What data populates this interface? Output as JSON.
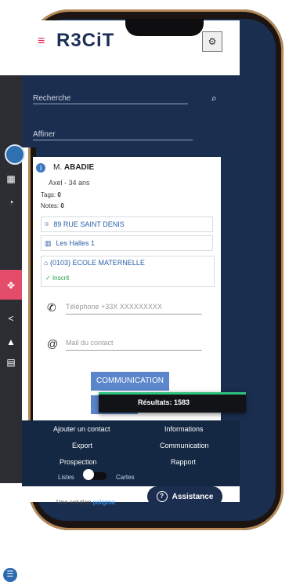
{
  "app": {
    "logo": "R3CiT"
  },
  "header": {
    "menu_icon": "≡",
    "user_gear_icon": "⚙"
  },
  "search": {
    "placeholder": "Recherche",
    "refine_placeholder": "Affiner"
  },
  "contact": {
    "name_prefix": "M.",
    "name": "ABADIE",
    "sub": "Axel - 34 ans",
    "tags_label": "Tags:",
    "tags_value": "0",
    "notes_label": "Notes:",
    "notes_value": "0",
    "address": "89 RUE SAINT DENIS",
    "district": "Les Halles 1",
    "school": "(0103) ECOLE MATERNELLE",
    "school_status": "Inscrit",
    "phone_placeholder": "Téléphone +33X XXXXXXXXX",
    "mail_placeholder": "Mail du contact"
  },
  "actions": {
    "communication": "COMMUNICATION"
  },
  "results": {
    "label": "Résultats:",
    "count": "1583"
  },
  "bottom_menu": {
    "add_contact": "Ajouter un contact",
    "informations": "Informations",
    "export": "Export",
    "communication": "Communication",
    "prospection": "Prospection",
    "rapport": "Rapport",
    "toggle_left": "Listes",
    "toggle_right": "Cartes"
  },
  "footer": {
    "prefix": "Une solution",
    "brand": "poligma"
  },
  "assistance": {
    "label": "Assistance"
  },
  "colors": {
    "navy": "#1b2e4f",
    "accent": "#e34d69",
    "button": "#5b86cc",
    "success": "#23a04a"
  }
}
